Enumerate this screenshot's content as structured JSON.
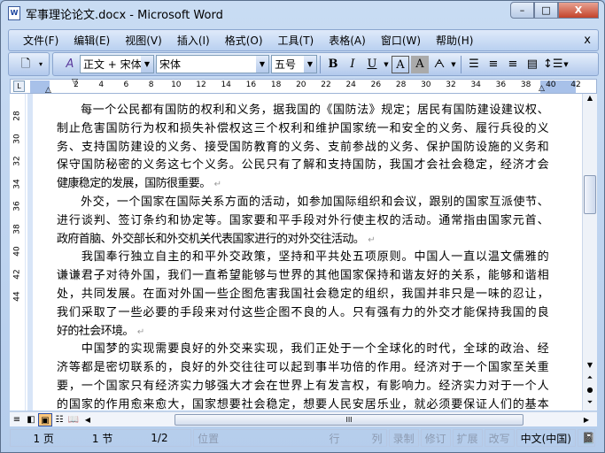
{
  "window": {
    "title": "军事理论论文.docx - Microsoft Word",
    "min": "–",
    "max": "□",
    "close": "X"
  },
  "menu": [
    "文件(F)",
    "编辑(E)",
    "视图(V)",
    "插入(I)",
    "格式(O)",
    "工具(T)",
    "表格(A)",
    "窗口(W)",
    "帮助(H)"
  ],
  "menu_close": "x",
  "toolbar": {
    "style": "正文 + 宋体",
    "font": "宋体",
    "size": "五号",
    "bold": "B",
    "italic": "I",
    "underline": "U"
  },
  "ruler": {
    "tab": "L",
    "numbers": [
      "2",
      "4",
      "6",
      "8",
      "10",
      "12",
      "14",
      "16",
      "18",
      "20",
      "22",
      "24",
      "26",
      "28",
      "30",
      "32",
      "34",
      "36",
      "38",
      "40",
      "42"
    ],
    "vnumbers": [
      "28",
      "30",
      "32",
      "34",
      "36",
      "38",
      "40",
      "42",
      "44"
    ]
  },
  "document": {
    "paragraphs": [
      [
        "　　每一个公民都有国防的权利和义务，据我国的《国防法》规定；居民有国防建设建议权、",
        "制止危害国防行为权和损失补偿权这三个权利和维护国家统一和安全的义务、履行兵役的义",
        "务、支持国防建设的义务、接受国防教育的义务、支前参战的义务、保护国防设施的义务和",
        "保守国防秘密的义务这七个义务。公民只有了解和支持国防，我国才会社会稳定，经济才会",
        "健康稳定的发展，国防很重要。"
      ],
      [
        "　　外交，一个国家在国际关系方面的活动，如参加国际组织和会议，跟别的国家互派使节、",
        "进行谈判、签订条约和协定等。国家要和平手段对外行使主权的活动。通常指由国家元首、",
        "政府首脑、外交部长和外交机关代表国家进行的对外交往活动。"
      ],
      [
        "　　我国奉行独立自主的和平外交政策，坚持和平共处五项原则。中国人一直以温文儒雅的",
        "谦谦君子对待外国，我们一直希望能够与世界的其他国家保持和谐友好的关系，能够和谐相",
        "处，共同发展。在面对外国一些企图危害我国社会稳定的组织，我国并非只是一味的忍让，",
        "我们采取了一些必要的手段来对付这些企图不良的人。只有强有力的外交才能保持我国的良",
        "好的社会环境。"
      ],
      [
        "　　中国梦的实现需要良好的外交来实现，我们正处于一个全球化的时代，全球的政治、经",
        "济等都是密切联系的，良好的外交往往可以起到事半功倍的作用。经济对于一个国家至关重",
        "要，一个国家只有经济实力够强大才会在世界上有发言权，有影响力。经济实力对于一个人",
        "的国家的作用愈来愈大，国家想要社会稳定，想要人民安居乐业，就必须要保证人们的基本"
      ]
    ],
    "para_mark": "↵"
  },
  "status": {
    "page": "1 页",
    "section": "1 节",
    "pages": "1/2",
    "position": "位置",
    "line": "行",
    "column": "列",
    "rec": "录制",
    "trk": "修订",
    "ext": "扩展",
    "ovr": "改写",
    "lang": "中文(中国)"
  }
}
